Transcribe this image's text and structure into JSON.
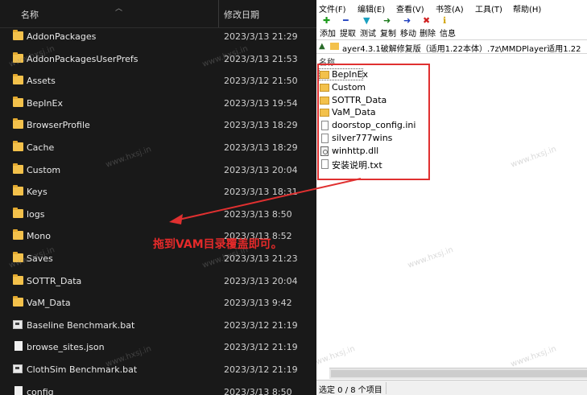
{
  "explorer": {
    "col_name": "名称",
    "col_date": "修改日期",
    "rows": [
      {
        "name": "AddonPackages",
        "date": "2023/3/13 21:29",
        "type": "folder"
      },
      {
        "name": "AddonPackagesUserPrefs",
        "date": "2023/3/13 21:53",
        "type": "folder"
      },
      {
        "name": "Assets",
        "date": "2023/3/12 21:50",
        "type": "folder"
      },
      {
        "name": "BepInEx",
        "date": "2023/3/13 19:54",
        "type": "folder"
      },
      {
        "name": "BrowserProfile",
        "date": "2023/3/13 18:29",
        "type": "folder"
      },
      {
        "name": "Cache",
        "date": "2023/3/13 18:29",
        "type": "folder"
      },
      {
        "name": "Custom",
        "date": "2023/3/13 20:04",
        "type": "folder"
      },
      {
        "name": "Keys",
        "date": "2023/3/13 18:31",
        "type": "folder"
      },
      {
        "name": "logs",
        "date": "2023/3/13 8:50",
        "type": "folder"
      },
      {
        "name": "Mono",
        "date": "2023/3/13 8:52",
        "type": "folder"
      },
      {
        "name": "Saves",
        "date": "2023/3/13 21:23",
        "type": "folder"
      },
      {
        "name": "SOTTR_Data",
        "date": "2023/3/13 20:04",
        "type": "folder"
      },
      {
        "name": "VaM_Data",
        "date": "2023/3/13 9:42",
        "type": "folder"
      },
      {
        "name": "Baseline Benchmark.bat",
        "date": "2023/3/12 21:19",
        "type": "bat"
      },
      {
        "name": "browse_sites.json",
        "date": "2023/3/12 21:19",
        "type": "file"
      },
      {
        "name": "ClothSim Benchmark.bat",
        "date": "2023/3/12 21:19",
        "type": "bat"
      },
      {
        "name": "config",
        "date": "2023/3/13 8:50",
        "type": "file"
      }
    ]
  },
  "archiver": {
    "menu": [
      "文件(F)",
      "编辑(E)",
      "查看(V)",
      "书签(A)",
      "工具(T)",
      "帮助(H)"
    ],
    "toolbar": [
      {
        "label": "添加",
        "icon": "plus-icon",
        "color": "#1a9a1a",
        "glyph": "✚"
      },
      {
        "label": "提取",
        "icon": "minus-icon",
        "color": "#1e3fbf",
        "glyph": "━"
      },
      {
        "label": "测试",
        "icon": "test-icon",
        "color": "#1aa0c0",
        "glyph": "▼"
      },
      {
        "label": "复制",
        "icon": "copy-arrow-icon",
        "color": "#1a7a1a",
        "glyph": "➜"
      },
      {
        "label": "移动",
        "icon": "move-arrow-icon",
        "color": "#1e3fbf",
        "glyph": "➜"
      },
      {
        "label": "删除",
        "icon": "delete-icon",
        "color": "#d02020",
        "glyph": "✖"
      },
      {
        "label": "信息",
        "icon": "info-icon",
        "color": "#d0a000",
        "glyph": "ℹ"
      }
    ],
    "address": "ayer4.3.1破解修复版（适用1.22本体）.7z\\MMDPlayer适用1.22",
    "col_name": "名称",
    "items": [
      {
        "name": "BepInEx",
        "type": "folder"
      },
      {
        "name": "Custom",
        "type": "folder"
      },
      {
        "name": "SOTTR_Data",
        "type": "folder"
      },
      {
        "name": "VaM_Data",
        "type": "folder"
      },
      {
        "name": "doorstop_config.ini",
        "type": "file"
      },
      {
        "name": "silver777wins",
        "type": "file"
      },
      {
        "name": "winhttp.dll",
        "type": "dll"
      },
      {
        "name": "安装说明.txt",
        "type": "file"
      }
    ],
    "status": "选定 0 / 8 个项目"
  },
  "annotation": {
    "text": "拖到VAM目录覆盖即可。",
    "color": "#e52a2a"
  },
  "watermark": "www.hxsj.in"
}
